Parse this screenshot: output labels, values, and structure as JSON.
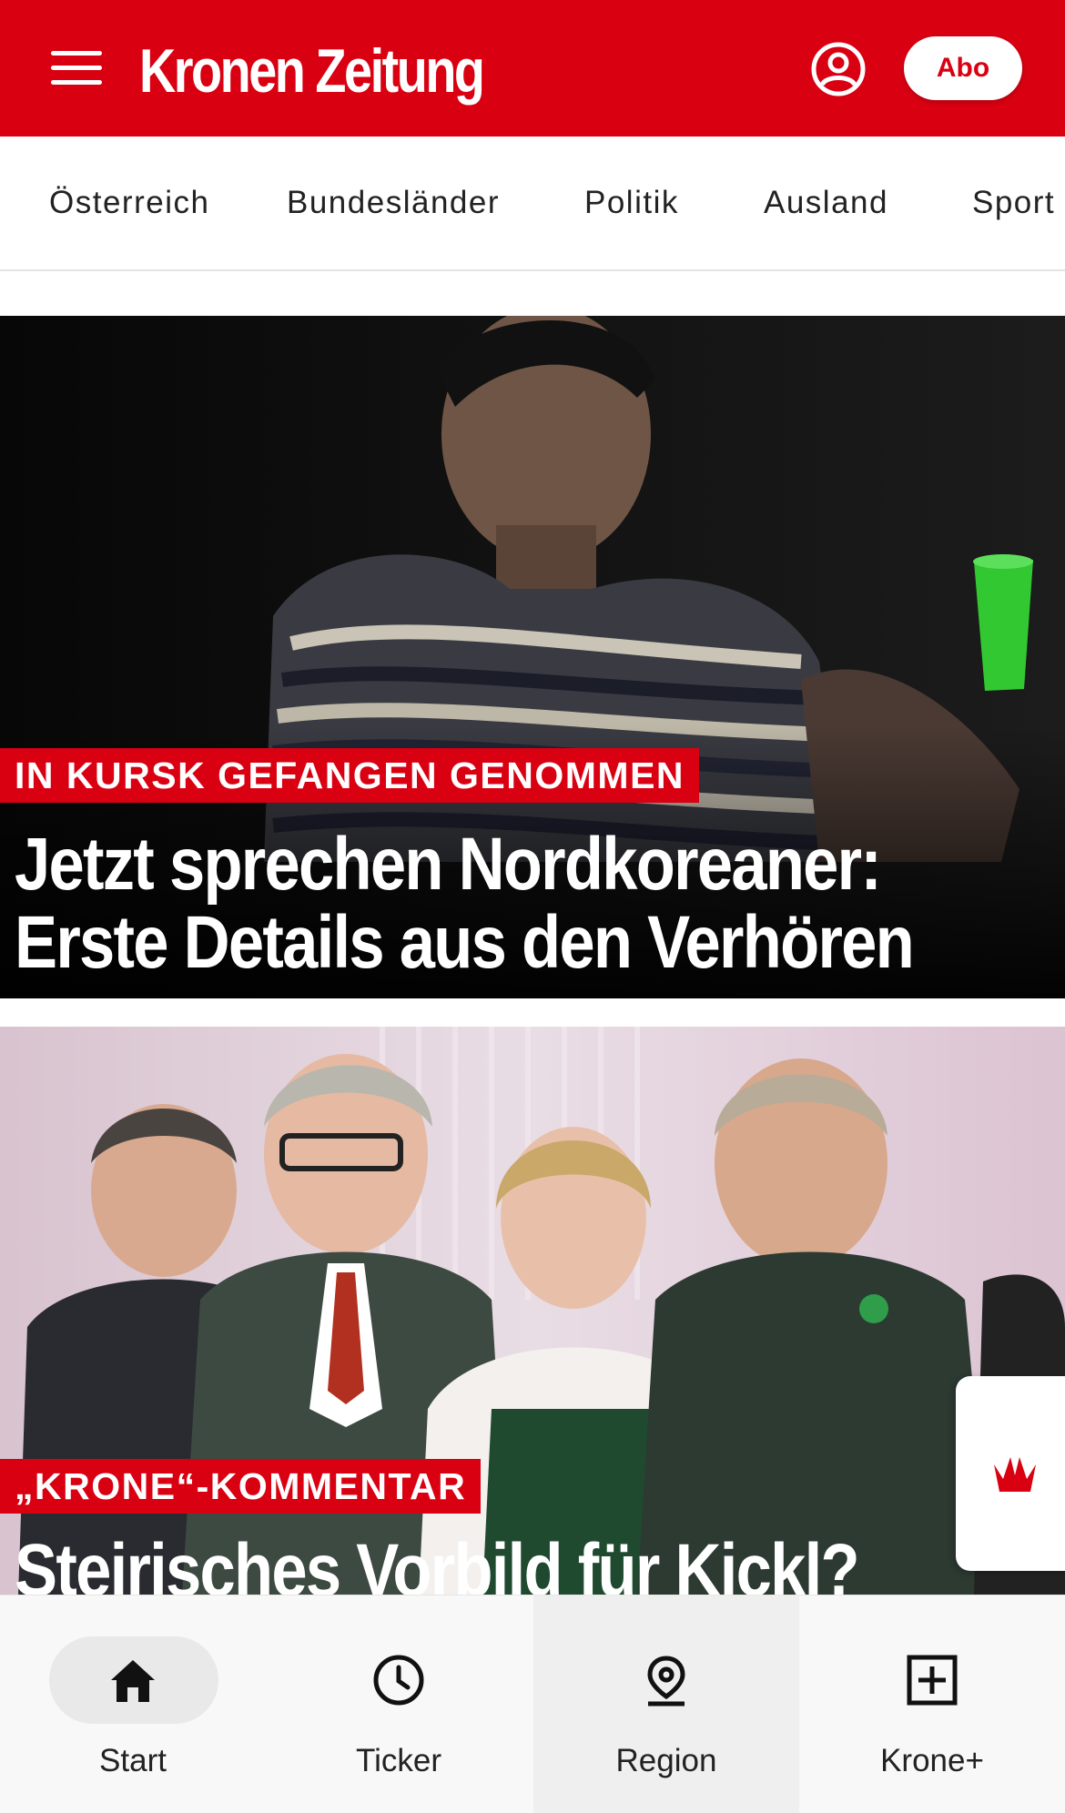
{
  "header": {
    "logo_text": "Kronen Zeitung",
    "abo_label": "Abo",
    "brand_color": "#d90012"
  },
  "categories": [
    "Österreich",
    "Bundesländer",
    "Politik",
    "Ausland",
    "Sport"
  ],
  "articles": [
    {
      "kicker": "IN KURSK GEFANGEN GENOMMEN",
      "headline_line1": "Jetzt sprechen Nordkoreaner:",
      "headline_line2": "Erste Details aus den Verhören"
    },
    {
      "kicker": "„KRONE“-KOMMENTAR",
      "headline_line1": "Steirisches Vorbild für Kickl?"
    }
  ],
  "bottom_nav": {
    "start": "Start",
    "ticker": "Ticker",
    "region": "Region",
    "krone_plus": "Krone+"
  },
  "icons": [
    "menu-icon",
    "user-icon",
    "home-icon",
    "clock-icon",
    "location-pin-icon",
    "plus-box-icon",
    "krone-crown-icon"
  ]
}
